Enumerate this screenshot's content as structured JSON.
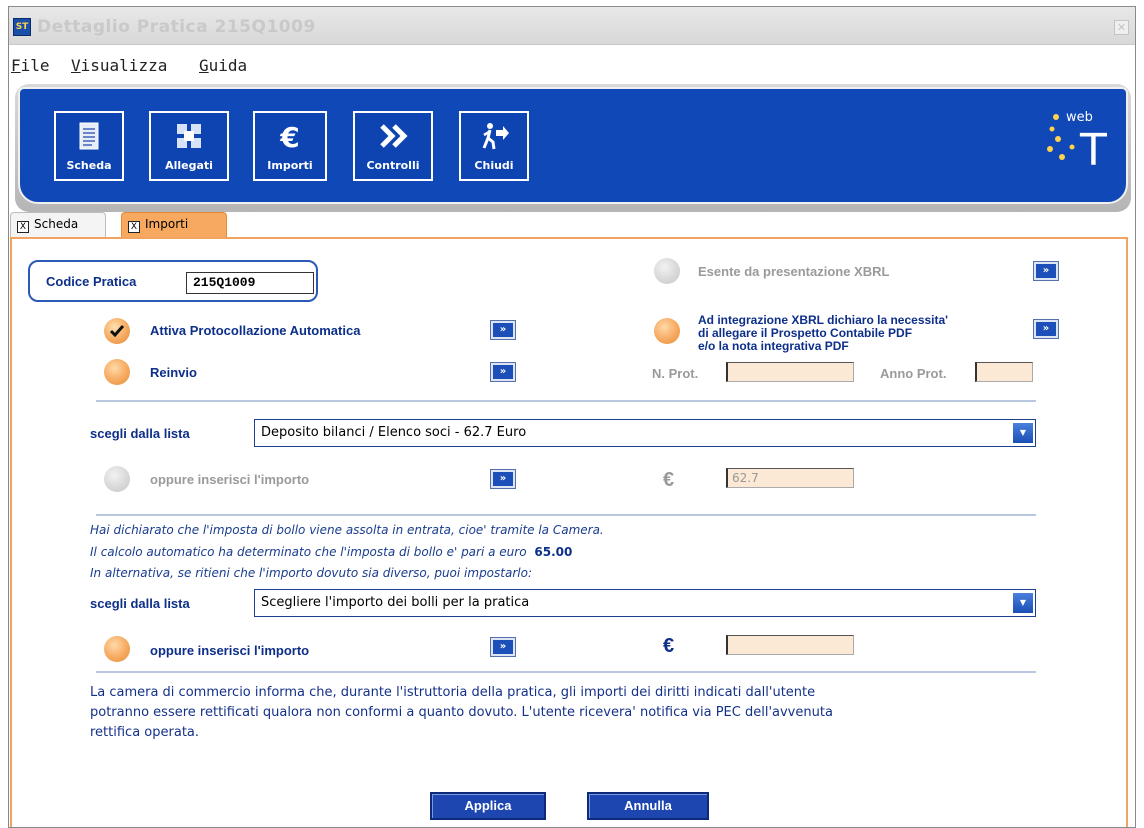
{
  "window": {
    "icon_text": "ST",
    "title": "Dettaglio Pratica 215Q1009",
    "close_symbol": "✕"
  },
  "menu": {
    "items": [
      {
        "label": "File",
        "mnemonic": "F"
      },
      {
        "label": "Visualizza",
        "mnemonic": "V"
      },
      {
        "label": "Guida",
        "mnemonic": "G"
      }
    ]
  },
  "toolbar": {
    "buttons": [
      {
        "label": "Scheda",
        "icon": "document-icon"
      },
      {
        "label": "Allegati",
        "icon": "attachments-icon"
      },
      {
        "label": "Importi",
        "icon": "euro-icon"
      },
      {
        "label": "Controlli",
        "icon": "double-chevron-icon"
      },
      {
        "label": "Chiudi",
        "icon": "exit-person-icon"
      }
    ],
    "logo_text": "web",
    "logo_letter": "T"
  },
  "tabs": [
    {
      "label": "Scheda",
      "active": false
    },
    {
      "label": "Importi",
      "active": true
    }
  ],
  "form": {
    "codice_label": "Codice Pratica",
    "codice_value": "215Q1009",
    "esente_label": "Esente da presentazione XBRL",
    "attiva_label": "Attiva Protocollazione Automatica",
    "integrazione_label_1": "Ad integrazione XBRL dichiaro la necessita'",
    "integrazione_label_2": "di allegare il Prospetto Contabile PDF",
    "integrazione_label_3": "e/o la nota integrativa PDF",
    "reinvio_label": "Reinvio",
    "nprot_label": "N. Prot.",
    "nprot_value": "",
    "annoprot_label": "Anno Prot.",
    "annoprot_value": "",
    "scegli_label": "scegli dalla lista",
    "diritti_select_value": "Deposito bilanci / Elenco soci - 62.7 Euro",
    "oppure_label": "oppure inserisci l'importo",
    "euro_symbol": "€",
    "diritti_importo_value": "62.7",
    "bollo_line_1": "Hai dichiarato che l'imposta di bollo viene assolta in entrata, cioe' tramite la Camera.",
    "bollo_line_2": "Il calcolo automatico ha determinato che l'imposta di bollo e' pari a euro",
    "bollo_amount": "65.00",
    "bollo_line_3": "In alternativa, se ritieni che l'importo dovuto sia diverso, puoi impostarlo:",
    "scegli_label_2": "scegli dalla lista",
    "bolli_select_value": "Scegliere l'importo dei bolli per la pratica",
    "oppure_label_2": "oppure inserisci l'importo",
    "euro_symbol_2": "€",
    "bolli_importo_value": "",
    "info_line_1": "La camera di commercio informa che, durante l'istruttoria della pratica, gli importi dei diritti indicati dall'utente",
    "info_line_2": "potranno essere rettificati qualora non conformi a quanto dovuto. L'utente ricevera' notifica via PEC dell'avvenuta",
    "info_line_3": "rettifica operata.",
    "arrow_glyph": "»",
    "apply_label": "Applica",
    "cancel_label": "Annulla"
  },
  "colors": {
    "toolbar_blue": "#1048b8",
    "accent_orange": "#f6a95f",
    "label_blue": "#0d2f8a"
  }
}
